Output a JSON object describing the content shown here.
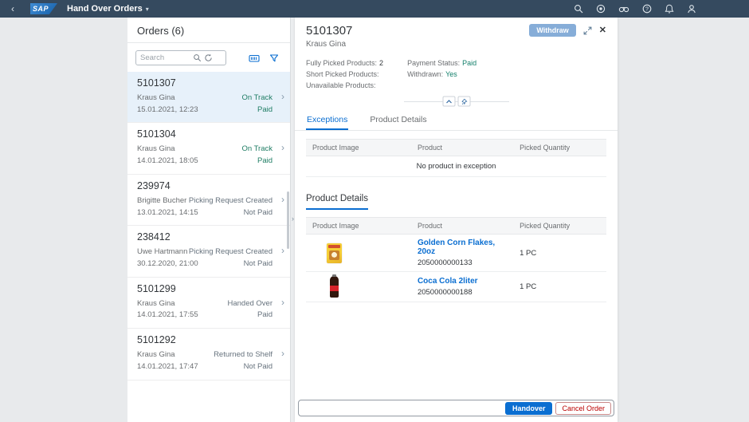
{
  "shell": {
    "logo": "SAP",
    "app_title": "Hand Over Orders",
    "icons": [
      "back-icon",
      "search-icon",
      "copilot-icon",
      "binoculars-icon",
      "help-icon",
      "notifications-icon",
      "profile-icon"
    ],
    "bar_color": "#354a5f"
  },
  "master": {
    "title": "Orders (6)",
    "search_placeholder": "Search",
    "toolbar_icons": [
      "search-icon",
      "refresh-icon",
      "barcode-scan-icon",
      "filter-icon"
    ],
    "items": [
      {
        "id": "5101307",
        "name": "Kraus Gina",
        "datetime": "15.01.2021, 12:23",
        "status": "On Track",
        "payment": "Paid",
        "selected": true,
        "positive": true
      },
      {
        "id": "5101304",
        "name": "Kraus Gina",
        "datetime": "14.01.2021, 18:05",
        "status": "On Track",
        "payment": "Paid",
        "selected": false,
        "positive": true
      },
      {
        "id": "239974",
        "name": "Brigitte Bucher",
        "datetime": "13.01.2021, 14:15",
        "status": "Picking Request Created",
        "payment": "Not Paid",
        "selected": false,
        "positive": false
      },
      {
        "id": "238412",
        "name": "Uwe Hartmann",
        "datetime": "30.12.2020, 21:00",
        "status": "Picking Request Created",
        "payment": "Not Paid",
        "selected": false,
        "positive": false
      },
      {
        "id": "5101299",
        "name": "Kraus Gina",
        "datetime": "14.01.2021, 17:55",
        "status": "Handed Over",
        "payment": "Paid",
        "selected": false,
        "positive": false
      },
      {
        "id": "5101292",
        "name": "Kraus Gina",
        "datetime": "14.01.2021, 17:47",
        "status": "Returned to Shelf",
        "payment": "Not Paid",
        "selected": false,
        "positive": false
      }
    ]
  },
  "detail": {
    "title": "5101307",
    "subtitle": "Kraus Gina",
    "withdraw_label": "Withdraw",
    "header_icons": [
      "expand-icon",
      "close-icon",
      "collapse-header-icon",
      "pin-icon"
    ],
    "facts": {
      "fully_picked": {
        "label": "Fully Picked Products:",
        "value": "2"
      },
      "short_picked": {
        "label": "Short Picked Products:",
        "value": ""
      },
      "unavailable": {
        "label": "Unavailable Products:",
        "value": ""
      },
      "payment_status": {
        "label": "Payment Status:",
        "value": "Paid"
      },
      "withdrawn": {
        "label": "Withdrawn:",
        "value": "Yes"
      }
    },
    "tabs": [
      "Exceptions",
      "Product Details"
    ],
    "exceptions": {
      "columns": [
        "Product Image",
        "Product",
        "Picked Quantity"
      ],
      "empty_text": "No product in exception"
    },
    "product_details": {
      "title": "Product Details",
      "columns": [
        "Product Image",
        "Product",
        "Picked Quantity"
      ],
      "rows": [
        {
          "name": "Golden Corn Flakes, 20oz",
          "ean": "2050000000133",
          "qty": "1 PC",
          "image": "cereal-box"
        },
        {
          "name": "Coca Cola 2liter",
          "ean": "2050000000188",
          "qty": "1 PC",
          "image": "cola-bottle"
        }
      ]
    },
    "footer": {
      "input_value": "",
      "handover_label": "Handover",
      "cancel_label": "Cancel Order"
    },
    "accent_color": "#0a6ed1",
    "positive_color": "#15806c"
  }
}
